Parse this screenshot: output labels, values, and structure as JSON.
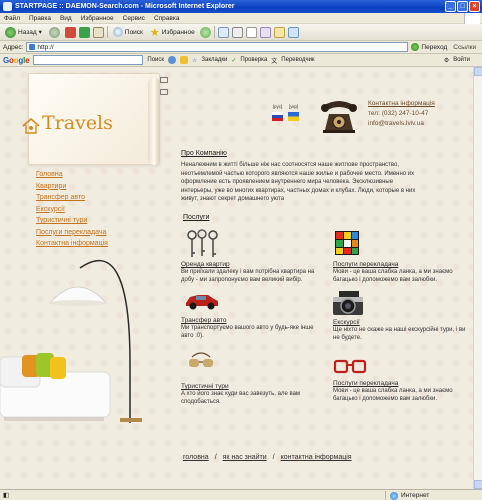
{
  "window": {
    "title": "STARTPAGE :: DAEMON-Search.com - Microsoft Internet Explorer"
  },
  "menu": [
    "Файл",
    "Правка",
    "Вид",
    "Избранное",
    "Сервис",
    "Справка"
  ],
  "toolbar": {
    "back_label": "Назад",
    "search_label": "Поиск",
    "favorites_label": "Избранное"
  },
  "address": {
    "label": "Адрес:",
    "value": "http://",
    "go_label": "Переход",
    "links_label": "Ссылки"
  },
  "googlebar": {
    "logo": [
      "G",
      "o",
      "o",
      "g",
      "l",
      "e"
    ],
    "search_label": "Поиск",
    "bookmarks_label": "Закладки",
    "check_label": "Проверка",
    "translate_label": "Переводчик",
    "signin_label": "Войти"
  },
  "site": {
    "logo_text": "Travels",
    "langs": [
      {
        "label": "[рус]",
        "flag": "ru"
      },
      {
        "label": "[укр]",
        "flag": "ua"
      }
    ],
    "contacts": {
      "title": "Контактна інформація",
      "phone": "тел: (032) 247-10-47",
      "email": "info@travels.lviv.ua"
    },
    "nav": [
      "Головна",
      "Квартири",
      "Трансфер авто",
      "Екскурсії",
      "Туристичні тури",
      "Послуги перекладача",
      "Контактна інформація"
    ],
    "about": {
      "title": "Про Компанію",
      "text": "Неналежним в житті більше ніж нас соотносятся наше житлове пространство, неотъемлемой частью которого являются наше жилье и рабочее место. Именно их оформление есть проявлением внутреннего мира человека. Эксклюзивные интерьеры, уже во многих квартирах, частных домах и клубах. Люди, которые в них живут, знают секрет домашнего уюта"
    },
    "services_title": "Послуги",
    "services": [
      {
        "title": "Оренда квартир",
        "text": "Ви приїхали здалеку і вам потрібна квартира на добу - ми запропонуємо вам великий вибір."
      },
      {
        "title": "Послуги перекладача",
        "text": "Мови - це ваша слабка ланка, а ми знаємо багацько і допоможемо вам залюбки."
      },
      {
        "title": "Трансфер авто",
        "text": "Ми транспортуємо вашого авто у будь-яке інше авто :0)."
      },
      {
        "title": "Екскурсії",
        "text": "Ще ніхто не скаже на наші екскурсійні тури, і ви не будете."
      },
      {
        "title": "Туристичні тури",
        "text": "А хто його знає куди вас завезуть, але вам сподобається."
      },
      {
        "title": "Послуги перекладача",
        "text": "Мови - це ваша слабка ланка, а ми знаємо багацько і допоможемо вам залюбки."
      }
    ],
    "footer": {
      "links": [
        "головна",
        "як нас знайти",
        "контактна інформація"
      ],
      "separator": "/"
    }
  },
  "status": {
    "zone": "Интернет"
  },
  "colors": {
    "accent": "#d98a1c",
    "title_bar": "#0a3fc0",
    "page_bg": "#f1ece0"
  }
}
